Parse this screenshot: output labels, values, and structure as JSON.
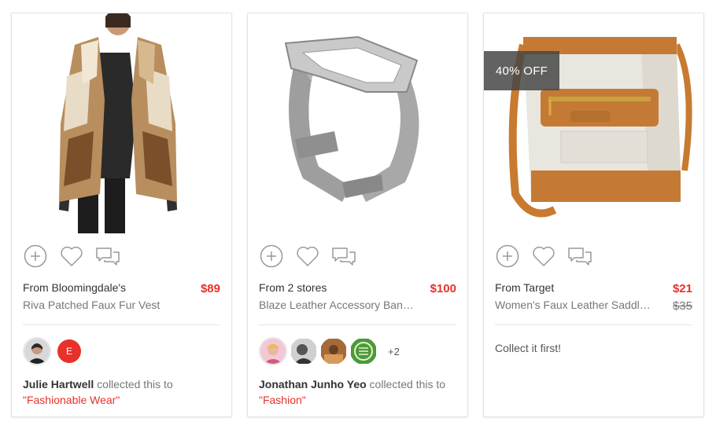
{
  "cards": [
    {
      "store": "From Bloomingdale's",
      "price": "$89",
      "name": "Riva Patched Faux Fur Vest",
      "collector": "Julie Hartwell",
      "collected_text": "collected this to",
      "collection": "\"Fashionable Wear\"",
      "avatar_letter": "E"
    },
    {
      "store": "From 2 stores",
      "price": "$100",
      "name": "Blaze Leather Accessory Band...",
      "collector": "Jonathan Junho Yeo",
      "collected_text": "collected this to",
      "collection": "\"Fashion\"",
      "more_count": "+2"
    },
    {
      "badge": "40% OFF",
      "store": "From Target",
      "price": "$21",
      "old_price": "$35",
      "name": "Women's Faux Leather Saddle...",
      "collect_first": "Collect it first!"
    }
  ],
  "icons": [
    "plus-circle-icon",
    "heart-icon",
    "comments-icon"
  ],
  "colors": {
    "accent": "#e8312a",
    "text": "#333333",
    "muted": "#777777",
    "badge": "#464646"
  }
}
